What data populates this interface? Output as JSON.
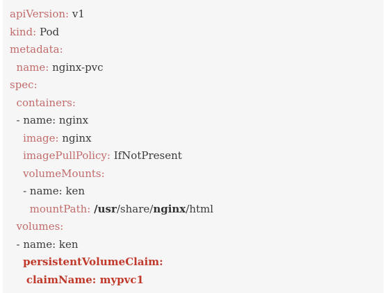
{
  "code": {
    "lines": [
      {
        "indent": "",
        "key": "apiVersion:",
        "value": " v1"
      },
      {
        "indent": "",
        "key": "kind:",
        "value": " Pod"
      },
      {
        "indent": "",
        "key": "metadata:",
        "value": ""
      },
      {
        "indent": "  ",
        "key": "name:",
        "value": " nginx-pvc"
      },
      {
        "indent": "",
        "key": "spec:",
        "value": ""
      },
      {
        "indent": "  ",
        "key": "containers:",
        "value": ""
      },
      {
        "indent": "  - ",
        "key": "name:",
        "value": " nginx"
      },
      {
        "indent": "    ",
        "key": "image:",
        "value": " nginx"
      },
      {
        "indent": "    ",
        "key": "imagePullPolicy:",
        "value": " IfNotPresent"
      },
      {
        "indent": "    ",
        "key": "volumeMounts:",
        "value": ""
      },
      {
        "indent": "    - ",
        "key": "name:",
        "value": " ken"
      },
      {
        "indent": "      ",
        "key": "mountPath:",
        "value": ""
      },
      {
        "indent": "  ",
        "key": "volumes:",
        "value": ""
      },
      {
        "indent": "  - ",
        "key": "name:",
        "value": " ken"
      },
      {
        "indent": "    ",
        "key": "persistentVolumeClaim:",
        "value": ""
      },
      {
        "indent": "     ",
        "key": "claimName:",
        "value": " mypvc1"
      }
    ],
    "mount_path_parts": [
      " ",
      "/usr",
      "/share/",
      "nginx",
      "/html"
    ]
  },
  "colors": {
    "key": "#c36b6b",
    "value": "#3a3a3a",
    "highlight": "#c0392b",
    "background": "#f6f6f6"
  }
}
